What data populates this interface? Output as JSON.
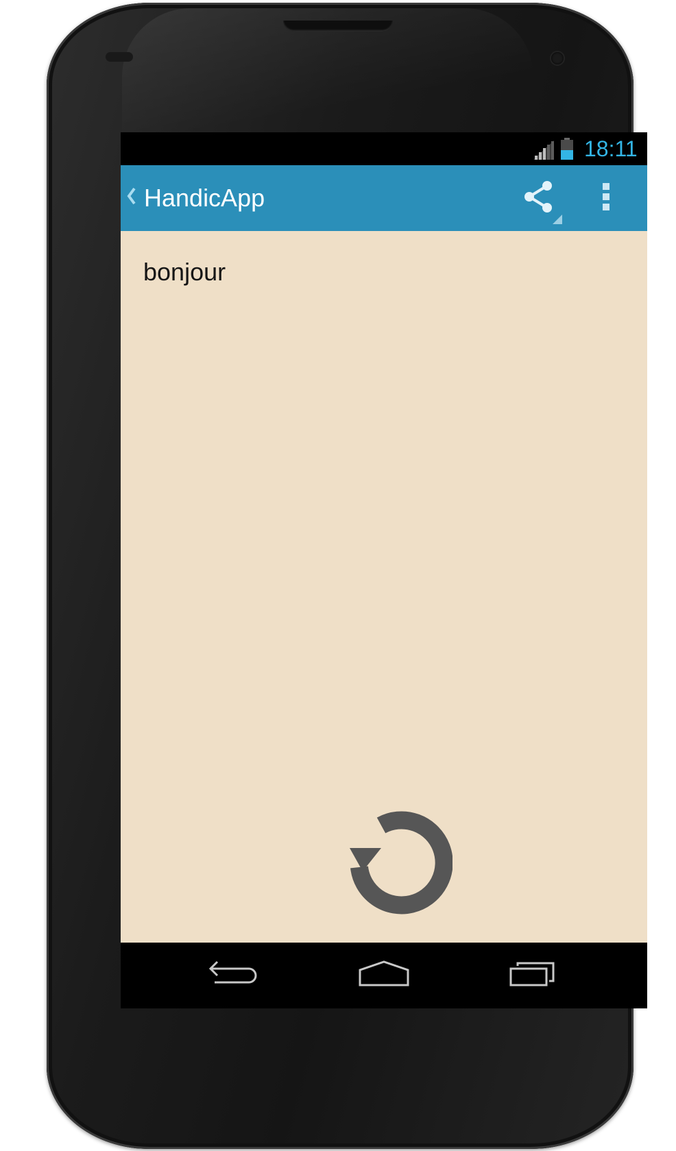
{
  "status_bar": {
    "time": "18:11",
    "clock_color": "#33b5e5"
  },
  "action_bar": {
    "title": "HandicApp",
    "background_color": "#2b8fb9",
    "actions": [
      {
        "icon": "share-icon"
      },
      {
        "icon": "overflow-menu-icon"
      }
    ]
  },
  "content": {
    "background_color": "#efdfc7",
    "message": "bonjour",
    "primary_action_icon": "refresh-icon"
  },
  "nav_bar": {
    "buttons": [
      {
        "icon": "back-icon"
      },
      {
        "icon": "home-icon"
      },
      {
        "icon": "recents-icon"
      }
    ]
  }
}
